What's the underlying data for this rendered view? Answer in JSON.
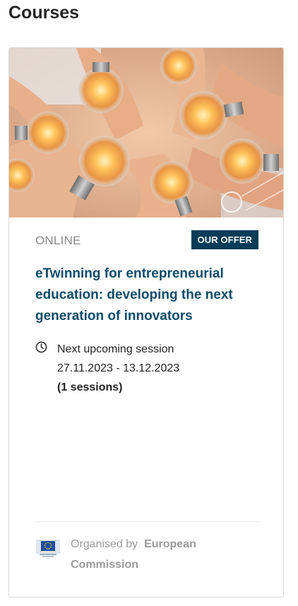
{
  "page": {
    "title": "Courses"
  },
  "course": {
    "mode": "ONLINE",
    "badge": "OUR OFFER",
    "title": "eTwinning for entrepreneurial education: developing the next generation of innovators",
    "session_label": "Next upcoming session",
    "session_dates": "27.11.2023 - 13.12.2023",
    "session_count": "(1 sessions)",
    "organised_by_label": "Organised by",
    "organiser": "European Commission",
    "image_alt": "hands-holding-light-bulbs",
    "icons": {
      "session": "clock-icon",
      "organiser": "eu-flag-logo"
    },
    "colors": {
      "title": "#0a4a67",
      "badge_bg": "#003c58",
      "muted": "#8a8a8a"
    }
  }
}
